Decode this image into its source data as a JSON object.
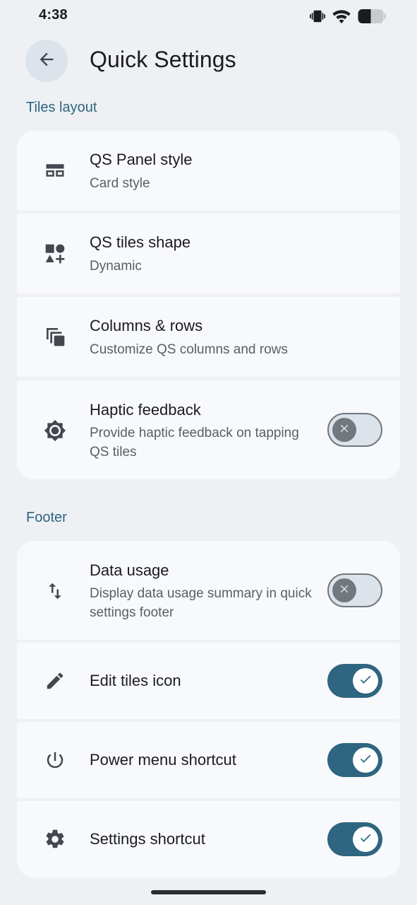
{
  "status_bar": {
    "time": "4:38",
    "icons": [
      "vibrate-icon",
      "wifi-icon",
      "battery-icon"
    ]
  },
  "header": {
    "back_icon": "arrow-back-icon",
    "title": "Quick Settings"
  },
  "sections": [
    {
      "title": "Tiles layout",
      "items": [
        {
          "icon": "panel-style-icon",
          "title": "QS Panel style",
          "subtitle": "Card style"
        },
        {
          "icon": "shapes-icon",
          "title": "QS tiles shape",
          "subtitle": "Dynamic"
        },
        {
          "icon": "copy-layers-icon",
          "title": "Columns & rows",
          "subtitle": "Customize QS columns and rows"
        },
        {
          "icon": "brightness-icon",
          "title": "Haptic feedback",
          "subtitle": "Provide haptic feedback on tapping QS tiles",
          "toggle": "off"
        }
      ]
    },
    {
      "title": "Footer",
      "items": [
        {
          "icon": "swap-vert-icon",
          "title": "Data usage",
          "subtitle": "Display data usage summary in quick settings footer",
          "toggle": "off"
        },
        {
          "icon": "pencil-icon",
          "title": "Edit tiles icon",
          "toggle": "on"
        },
        {
          "icon": "power-icon",
          "title": "Power menu shortcut",
          "toggle": "on"
        },
        {
          "icon": "gear-icon",
          "title": "Settings shortcut",
          "toggle": "on"
        }
      ]
    }
  ],
  "colors": {
    "background": "#EEF0F4",
    "card": "#F8F9FC",
    "accent": "#2E6580",
    "switch_off_track": "#DCE3EA",
    "switch_off_outline": "#72787E"
  }
}
